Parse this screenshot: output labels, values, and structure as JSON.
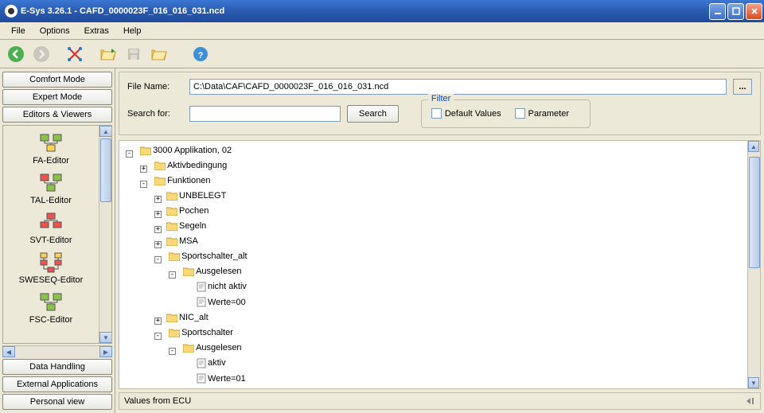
{
  "window": {
    "title": "E-Sys 3.26.1 - CAFD_0000023F_016_016_031.ncd"
  },
  "menu": [
    "File",
    "Options",
    "Extras",
    "Help"
  ],
  "sidebar": {
    "buttons_top": [
      "Comfort Mode",
      "Expert Mode",
      "Editors & Viewers"
    ],
    "editors": [
      {
        "label": "FA-Editor"
      },
      {
        "label": "TAL-Editor"
      },
      {
        "label": "SVT-Editor"
      },
      {
        "label": "SWESEQ-Editor"
      },
      {
        "label": "FSC-Editor"
      }
    ],
    "buttons_bottom": [
      "Data Handling",
      "External Applications",
      "Personal view"
    ]
  },
  "form": {
    "file_label": "File Name:",
    "file_value": "C:\\Data\\CAF\\CAFD_0000023F_016_016_031.ncd",
    "browse": "...",
    "search_label": "Search for:",
    "search_value": "",
    "search_btn": "Search",
    "filter_legend": "Filter",
    "filter_default": "Default Values",
    "filter_param": "Parameter"
  },
  "tree": {
    "root_app": "3000 Applikation, 02",
    "aktivbedingung": "Aktivbedingung",
    "funktionen": "Funktionen",
    "unbelegt": "UNBELEGT",
    "pochen": "Pochen",
    "segeln": "Segeln",
    "msa": "MSA",
    "sportschalter_alt": "Sportschalter_alt",
    "ausgelesen1": "Ausgelesen",
    "nicht_aktiv": "nicht aktiv",
    "werte00": "Werte=00",
    "nic_alt": "NIC_alt",
    "sportschalter": "Sportschalter",
    "ausgelesen2": "Ausgelesen",
    "aktiv": "aktiv",
    "werte01": "Werte=01"
  },
  "bottom": {
    "label": "Values from ECU"
  }
}
